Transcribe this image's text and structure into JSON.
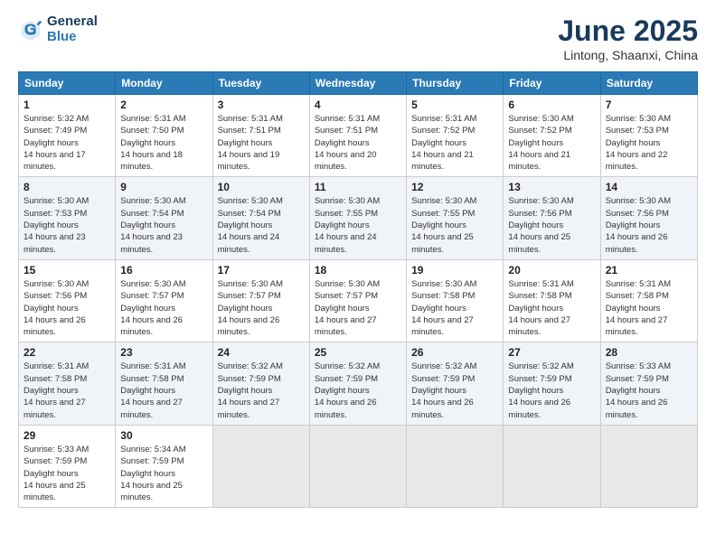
{
  "logo": {
    "general": "General",
    "blue": "Blue"
  },
  "title": "June 2025",
  "location": "Lintong, Shaanxi, China",
  "weekdays": [
    "Sunday",
    "Monday",
    "Tuesday",
    "Wednesday",
    "Thursday",
    "Friday",
    "Saturday"
  ],
  "weeks": [
    [
      {
        "day": "1",
        "sunrise": "5:32 AM",
        "sunset": "7:49 PM",
        "daylight": "14 hours and 17 minutes."
      },
      {
        "day": "2",
        "sunrise": "5:31 AM",
        "sunset": "7:50 PM",
        "daylight": "14 hours and 18 minutes."
      },
      {
        "day": "3",
        "sunrise": "5:31 AM",
        "sunset": "7:51 PM",
        "daylight": "14 hours and 19 minutes."
      },
      {
        "day": "4",
        "sunrise": "5:31 AM",
        "sunset": "7:51 PM",
        "daylight": "14 hours and 20 minutes."
      },
      {
        "day": "5",
        "sunrise": "5:31 AM",
        "sunset": "7:52 PM",
        "daylight": "14 hours and 21 minutes."
      },
      {
        "day": "6",
        "sunrise": "5:30 AM",
        "sunset": "7:52 PM",
        "daylight": "14 hours and 21 minutes."
      },
      {
        "day": "7",
        "sunrise": "5:30 AM",
        "sunset": "7:53 PM",
        "daylight": "14 hours and 22 minutes."
      }
    ],
    [
      {
        "day": "8",
        "sunrise": "5:30 AM",
        "sunset": "7:53 PM",
        "daylight": "14 hours and 23 minutes."
      },
      {
        "day": "9",
        "sunrise": "5:30 AM",
        "sunset": "7:54 PM",
        "daylight": "14 hours and 23 minutes."
      },
      {
        "day": "10",
        "sunrise": "5:30 AM",
        "sunset": "7:54 PM",
        "daylight": "14 hours and 24 minutes."
      },
      {
        "day": "11",
        "sunrise": "5:30 AM",
        "sunset": "7:55 PM",
        "daylight": "14 hours and 24 minutes."
      },
      {
        "day": "12",
        "sunrise": "5:30 AM",
        "sunset": "7:55 PM",
        "daylight": "14 hours and 25 minutes."
      },
      {
        "day": "13",
        "sunrise": "5:30 AM",
        "sunset": "7:56 PM",
        "daylight": "14 hours and 25 minutes."
      },
      {
        "day": "14",
        "sunrise": "5:30 AM",
        "sunset": "7:56 PM",
        "daylight": "14 hours and 26 minutes."
      }
    ],
    [
      {
        "day": "15",
        "sunrise": "5:30 AM",
        "sunset": "7:56 PM",
        "daylight": "14 hours and 26 minutes."
      },
      {
        "day": "16",
        "sunrise": "5:30 AM",
        "sunset": "7:57 PM",
        "daylight": "14 hours and 26 minutes."
      },
      {
        "day": "17",
        "sunrise": "5:30 AM",
        "sunset": "7:57 PM",
        "daylight": "14 hours and 26 minutes."
      },
      {
        "day": "18",
        "sunrise": "5:30 AM",
        "sunset": "7:57 PM",
        "daylight": "14 hours and 27 minutes."
      },
      {
        "day": "19",
        "sunrise": "5:30 AM",
        "sunset": "7:58 PM",
        "daylight": "14 hours and 27 minutes."
      },
      {
        "day": "20",
        "sunrise": "5:31 AM",
        "sunset": "7:58 PM",
        "daylight": "14 hours and 27 minutes."
      },
      {
        "day": "21",
        "sunrise": "5:31 AM",
        "sunset": "7:58 PM",
        "daylight": "14 hours and 27 minutes."
      }
    ],
    [
      {
        "day": "22",
        "sunrise": "5:31 AM",
        "sunset": "7:58 PM",
        "daylight": "14 hours and 27 minutes."
      },
      {
        "day": "23",
        "sunrise": "5:31 AM",
        "sunset": "7:58 PM",
        "daylight": "14 hours and 27 minutes."
      },
      {
        "day": "24",
        "sunrise": "5:32 AM",
        "sunset": "7:59 PM",
        "daylight": "14 hours and 27 minutes."
      },
      {
        "day": "25",
        "sunrise": "5:32 AM",
        "sunset": "7:59 PM",
        "daylight": "14 hours and 26 minutes."
      },
      {
        "day": "26",
        "sunrise": "5:32 AM",
        "sunset": "7:59 PM",
        "daylight": "14 hours and 26 minutes."
      },
      {
        "day": "27",
        "sunrise": "5:32 AM",
        "sunset": "7:59 PM",
        "daylight": "14 hours and 26 minutes."
      },
      {
        "day": "28",
        "sunrise": "5:33 AM",
        "sunset": "7:59 PM",
        "daylight": "14 hours and 26 minutes."
      }
    ],
    [
      {
        "day": "29",
        "sunrise": "5:33 AM",
        "sunset": "7:59 PM",
        "daylight": "14 hours and 25 minutes."
      },
      {
        "day": "30",
        "sunrise": "5:34 AM",
        "sunset": "7:59 PM",
        "daylight": "14 hours and 25 minutes."
      },
      null,
      null,
      null,
      null,
      null
    ]
  ]
}
